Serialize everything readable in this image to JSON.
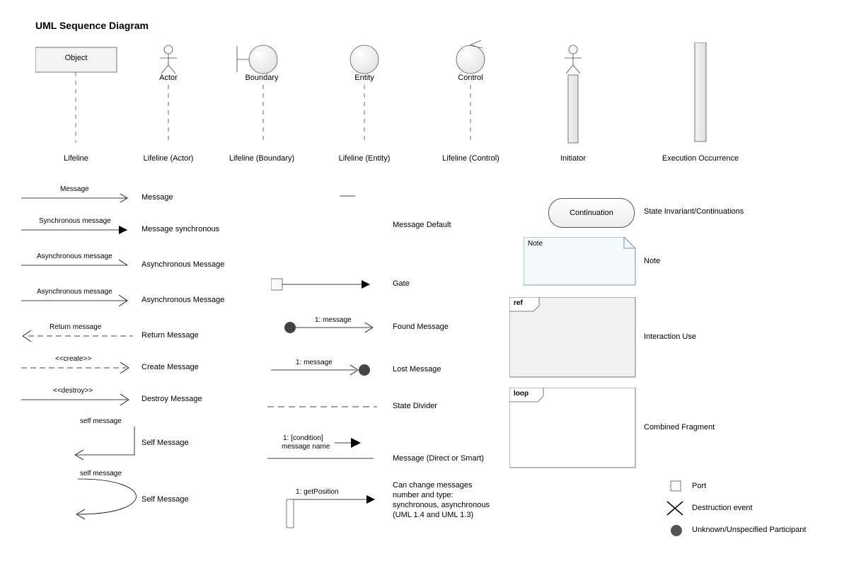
{
  "title": "UML Sequence Diagram",
  "row1": {
    "object": "Object",
    "actor": "Actor",
    "boundary": "Boundary",
    "entity": "Entity",
    "control": "Control",
    "lifeline": "Lifeline",
    "lifeline_actor": "Lifeline (Actor)",
    "lifeline_boundary": "Lifeline (Boundary)",
    "lifeline_entity": "Lifeline (Entity)",
    "lifeline_control": "Lifeline (Control)",
    "initiator": "Initiator",
    "execution": "Execution Occurrence"
  },
  "col1": {
    "message_text": "Message",
    "message_desc": "Message",
    "sync_text": "Synchronous message",
    "sync_desc": "Message synchronous",
    "async_text": "Asynchronous message",
    "async_desc": "Asynchronous Message",
    "async2_text": "Asynchronous message",
    "async2_desc": "Asynchronous Message",
    "return_text": "Return message",
    "return_desc": "Return Message",
    "create_text": "<<create>>",
    "create_desc": "Create Message",
    "destroy_text": "<<destroy>>",
    "destroy_desc": "Destroy Message",
    "self_text": "self message",
    "self_desc": "Self Message",
    "self2_text": "self message",
    "self2_desc": "Self Message"
  },
  "col2": {
    "default_desc": "Message Default",
    "gate_desc": "Gate",
    "found_text": "1: message",
    "found_desc": "Found Message",
    "lost_text": "1: message",
    "lost_desc": "Lost Message",
    "divider_desc": "State Divider",
    "direct_text1": "1: [condition]",
    "direct_text2": "message name",
    "direct_desc": "Message (Direct or Smart)",
    "getpos_text": "1: getPosition",
    "getpos_desc1": "Can change messages",
    "getpos_desc2": "number and type:",
    "getpos_desc3": "synchronous, asynchronous",
    "getpos_desc4": "(UML 1.4 and UML 1.3)"
  },
  "col3": {
    "continuation": "Continuation",
    "continuation_desc": "State Invariant/Continuations",
    "note": "Note",
    "note_desc": "Note",
    "ref": "ref",
    "ref_desc": "Interaction Use",
    "loop": "loop",
    "loop_desc": "Combined Fragment",
    "port_desc": "Port",
    "destruction_desc": "Destruction event",
    "unknown_desc": "Unknown/Unspecified Participant"
  }
}
